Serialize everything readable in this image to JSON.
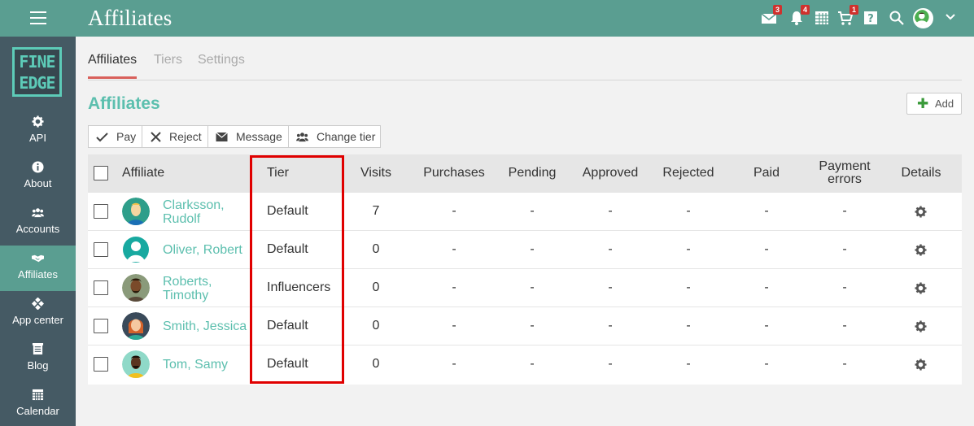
{
  "app": {
    "title": "Affiliates"
  },
  "topbar": {
    "icons": [
      {
        "name": "mail-icon",
        "badge": "3"
      },
      {
        "name": "bell-icon",
        "badge": "4"
      },
      {
        "name": "calendar-grid-icon",
        "badge": ""
      },
      {
        "name": "cart-icon",
        "badge": "1"
      },
      {
        "name": "help-icon",
        "badge": ""
      },
      {
        "name": "search-icon",
        "badge": ""
      }
    ]
  },
  "sidebar": {
    "logo": {
      "line1": "FINE",
      "line2": "EDGE"
    },
    "items": [
      {
        "label": "API",
        "icon": "gear-icon"
      },
      {
        "label": "About",
        "icon": "info-icon"
      },
      {
        "label": "Accounts",
        "icon": "users-icon"
      },
      {
        "label": "Affiliates",
        "icon": "handshake-icon",
        "active": true
      },
      {
        "label": "App center",
        "icon": "app-center-icon"
      },
      {
        "label": "Blog",
        "icon": "blog-icon"
      },
      {
        "label": "Calendar",
        "icon": "calendar-icon"
      }
    ]
  },
  "tabs": [
    {
      "label": "Affiliates",
      "active": true
    },
    {
      "label": "Tiers"
    },
    {
      "label": "Settings"
    }
  ],
  "section": {
    "title": "Affiliates",
    "add_label": "Add"
  },
  "toolbar": {
    "pay": "Pay",
    "reject": "Reject",
    "message": "Message",
    "change_tier": "Change tier"
  },
  "table": {
    "headers": {
      "affiliate": "Affiliate",
      "tier": "Tier",
      "visits": "Visits",
      "purchases": "Purchases",
      "pending": "Pending",
      "approved": "Approved",
      "rejected": "Rejected",
      "paid": "Paid",
      "payment_errors_1": "Payment",
      "payment_errors_2": "errors",
      "details": "Details"
    },
    "rows": [
      {
        "name1": "Clarksson,",
        "name2": "Rudolf",
        "tier": "Default",
        "visits": "7",
        "purchases": "-",
        "pending": "-",
        "approved": "-",
        "rejected": "-",
        "paid": "-",
        "payment_errors": "-"
      },
      {
        "name1": "Oliver, Robert",
        "name2": "",
        "tier": "Default",
        "visits": "0",
        "purchases": "-",
        "pending": "-",
        "approved": "-",
        "rejected": "-",
        "paid": "-",
        "payment_errors": "-"
      },
      {
        "name1": "Roberts,",
        "name2": "Timothy",
        "tier": "Influencers",
        "visits": "0",
        "purchases": "-",
        "pending": "-",
        "approved": "-",
        "rejected": "-",
        "paid": "-",
        "payment_errors": "-"
      },
      {
        "name1": "Smith, Jessica",
        "name2": "",
        "tier": "Default",
        "visits": "0",
        "purchases": "-",
        "pending": "-",
        "approved": "-",
        "rejected": "-",
        "paid": "-",
        "payment_errors": "-"
      },
      {
        "name1": "Tom, Samy",
        "name2": "",
        "tier": "Default",
        "visits": "0",
        "purchases": "-",
        "pending": "-",
        "approved": "-",
        "rejected": "-",
        "paid": "-",
        "payment_errors": "-"
      }
    ]
  },
  "colors": {
    "accent": "#5a9e91",
    "link": "#5cbfae",
    "sidebar": "#455a64",
    "highlight": "#e00000",
    "badge": "#d0312d"
  }
}
